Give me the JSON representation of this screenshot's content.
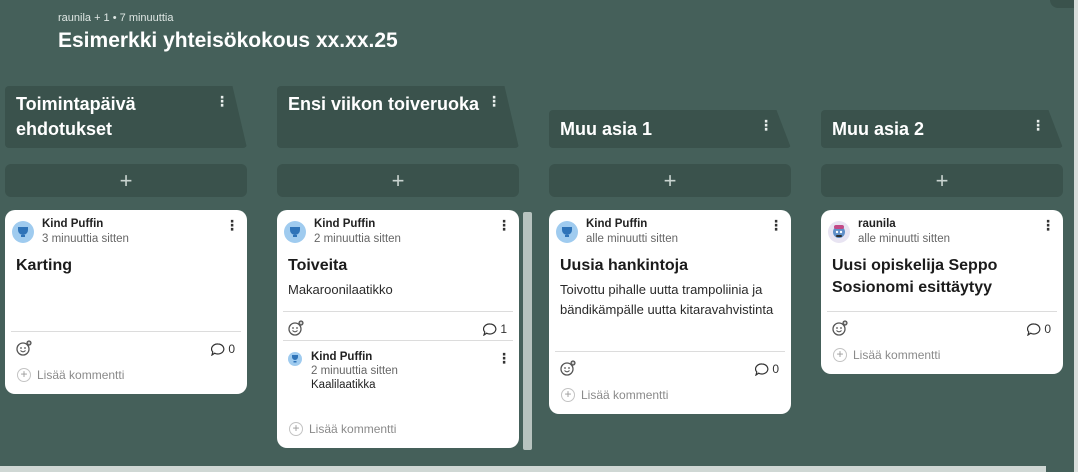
{
  "board": {
    "meta": "raunila + 1 • 7 minuuttia",
    "title": "Esimerkki yhteisökokous xx.xx.25"
  },
  "icons": {
    "column_menu": "more-vertical-icon",
    "add": "plus-icon",
    "reaction": "add-reaction-icon",
    "comment": "comment-bubble-icon",
    "avatar_puffin": "trophy-avatar-icon",
    "avatar_raunila": "character-avatar-icon"
  },
  "colors": {
    "background": "#45605a",
    "column_header": "#3a524c",
    "card": "#ffffff",
    "avatar_blue": "#9fcbef"
  },
  "columns": [
    {
      "title": "Toimintapäivä ehdotukset",
      "add_label": "+",
      "card": {
        "author": "Kind Puffin",
        "time": "3 minuuttia sitten",
        "title": "Karting",
        "body": "",
        "comment_count": "0",
        "add_comment": "Lisää kommentti"
      }
    },
    {
      "title": "Ensi viikon toiveruoka",
      "add_label": "+",
      "card": {
        "author": "Kind Puffin",
        "time": "2 minuuttia sitten",
        "title": "Toiveita",
        "body": "Makaroonilaatikko",
        "comment_count": "1",
        "comments": [
          {
            "author": "Kind Puffin",
            "time": "2 minuuttia sitten",
            "text": "Kaalilaatikka"
          }
        ],
        "add_comment": "Lisää kommentti"
      }
    },
    {
      "title": "Muu asia 1",
      "add_label": "+",
      "card": {
        "author": "Kind Puffin",
        "time": "alle minuutti sitten",
        "title": "Uusia hankintoja",
        "body": "Toivottu pihalle uutta trampoliinia ja bändikämpälle uutta kitaravahvistinta",
        "comment_count": "0",
        "add_comment": "Lisää kommentti"
      }
    },
    {
      "title": "Muu asia 2",
      "add_label": "+",
      "card": {
        "author": "raunila",
        "time": "alle minuutti sitten",
        "title": "Uusi opiskelija Seppo Sosionomi esittäytyy",
        "body": "",
        "comment_count": "0",
        "add_comment": "Lisää kommentti"
      }
    }
  ]
}
